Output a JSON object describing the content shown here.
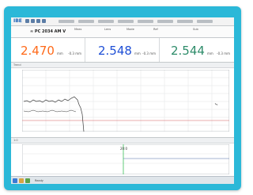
{
  "app": {
    "logo": "IBE"
  },
  "info": {
    "title": "≈ PC 2034 AM V",
    "fields": [
      "Meas",
      "Lens",
      "Mode",
      "Ref",
      "Sub"
    ]
  },
  "readouts": [
    {
      "value": "2.470",
      "unit": "mm",
      "side": "-0.3 mm",
      "color": "#ff6a1a"
    },
    {
      "value": "2.548",
      "unit": "mm",
      "side": "-0.3 mm",
      "color": "#1f4fd6"
    },
    {
      "value": "2.544",
      "unit": "mm",
      "side": "-0.3 mm",
      "color": "#2e8c6a"
    }
  ],
  "upper_panel": {
    "title": "Trend"
  },
  "lower_panel": {
    "title": "1:0",
    "marker": "20:0"
  },
  "taskbar": {
    "status": "Ready"
  },
  "colors": {
    "frame": "#2bb8d8",
    "signal": "#3a3a3a",
    "limit": "#d65b5b",
    "marker": "#3bbf5a"
  }
}
